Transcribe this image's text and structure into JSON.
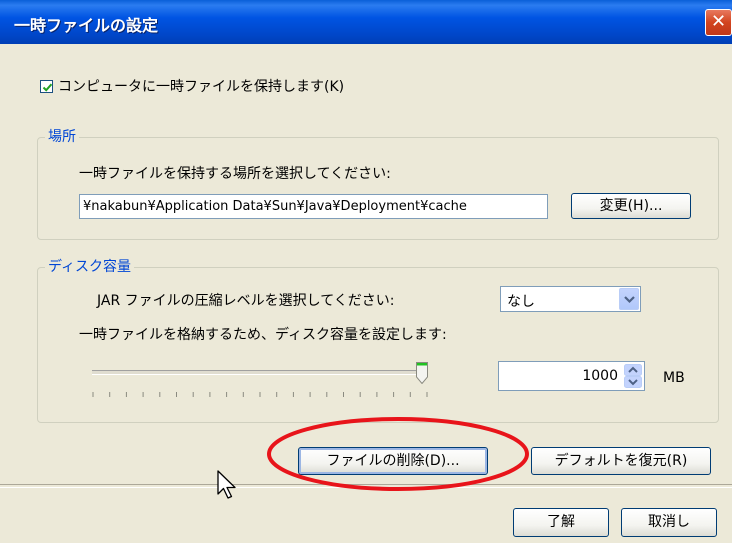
{
  "window": {
    "title": "一時ファイルの設定",
    "close_label": "✕"
  },
  "keep_files_checkbox": {
    "checked": true,
    "label": "コンピュータに一時ファイルを保持します(K)"
  },
  "location_group": {
    "legend": "場所",
    "instruction": "一時ファイルを保持する場所を選択してください:",
    "path_value": "¥nakabun¥Application Data¥Sun¥Java¥Deployment¥cache",
    "change_button": "変更(H)..."
  },
  "disk_group": {
    "legend": "ディスク容量",
    "compression_label": "JAR ファイルの圧縮レベルを選択してください:",
    "compression_value": "なし",
    "space_label": "一時ファイルを格納するため、ディスク容量を設定します:",
    "slider_level": 1.0,
    "space_value": "1000",
    "space_unit": "MB"
  },
  "buttons": {
    "delete_files": "ファイルの削除(D)...",
    "restore_defaults": "デフォルトを復元(R)",
    "ok": "了解",
    "cancel": "取消し"
  },
  "colors": {
    "legend": "#0046d5",
    "annotation_ellipse": "#e8141a"
  }
}
